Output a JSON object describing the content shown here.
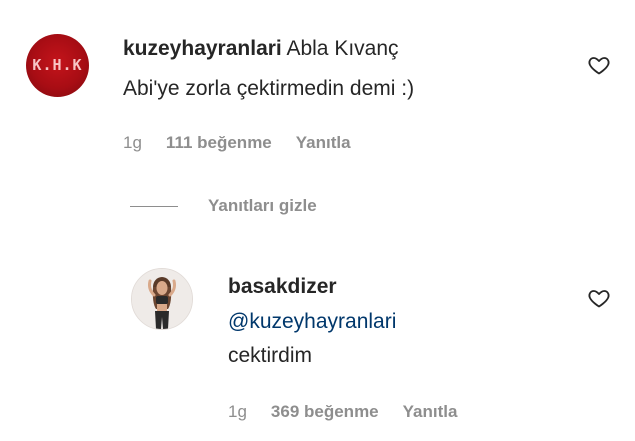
{
  "comment": {
    "username": "kuzeyhayranlari",
    "text_line1": "Abla Kıvanç",
    "text_line2": "Abi'ye zorla çektirmedin demi :)",
    "time": "1g",
    "likes": "111 beğenme",
    "reply_label": "Yanıtla",
    "avatar_logo_text": "K.H.K"
  },
  "replies_toggle": {
    "label": "Yanıtları gizle"
  },
  "reply": {
    "username": "basakdizer",
    "mention": "@kuzeyhayranlari",
    "text": "cektirdim",
    "time": "1g",
    "likes": "369 beğenme",
    "reply_label": "Yanıtla"
  },
  "icons": {
    "like": "heart-outline-icon"
  },
  "colors": {
    "avatar_red": "#b30f16",
    "mention_blue": "#00376b",
    "meta_gray": "#8e8e8e"
  }
}
